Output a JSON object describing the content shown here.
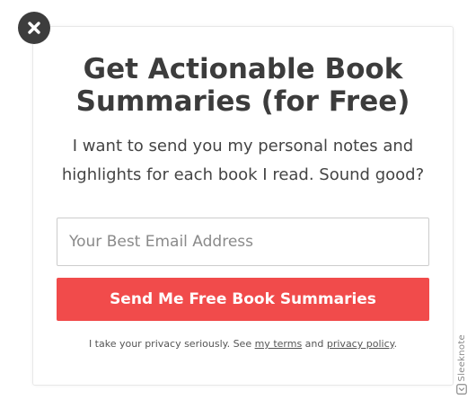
{
  "popup": {
    "title": "Get Actionable Book Summaries (for Free)",
    "subtitle": "I want to send you my personal notes and highlights for each book I read. Sound good?",
    "email_placeholder": "Your Best Email Address",
    "submit_label": "Send Me Free Book Summaries",
    "privacy": {
      "prefix": "I take your privacy seriously. See ",
      "terms_link": "my terms",
      "middle": " and ",
      "policy_link": "privacy policy",
      "suffix": "."
    }
  },
  "branding": {
    "label": "Sleeknote"
  },
  "icons": {
    "close": "close-x-icon",
    "brand": "sleeknote-logo-icon"
  },
  "colors": {
    "accent": "#f14b4b",
    "close_button": "#3d3d3d",
    "title_text": "#3c3c3c"
  }
}
